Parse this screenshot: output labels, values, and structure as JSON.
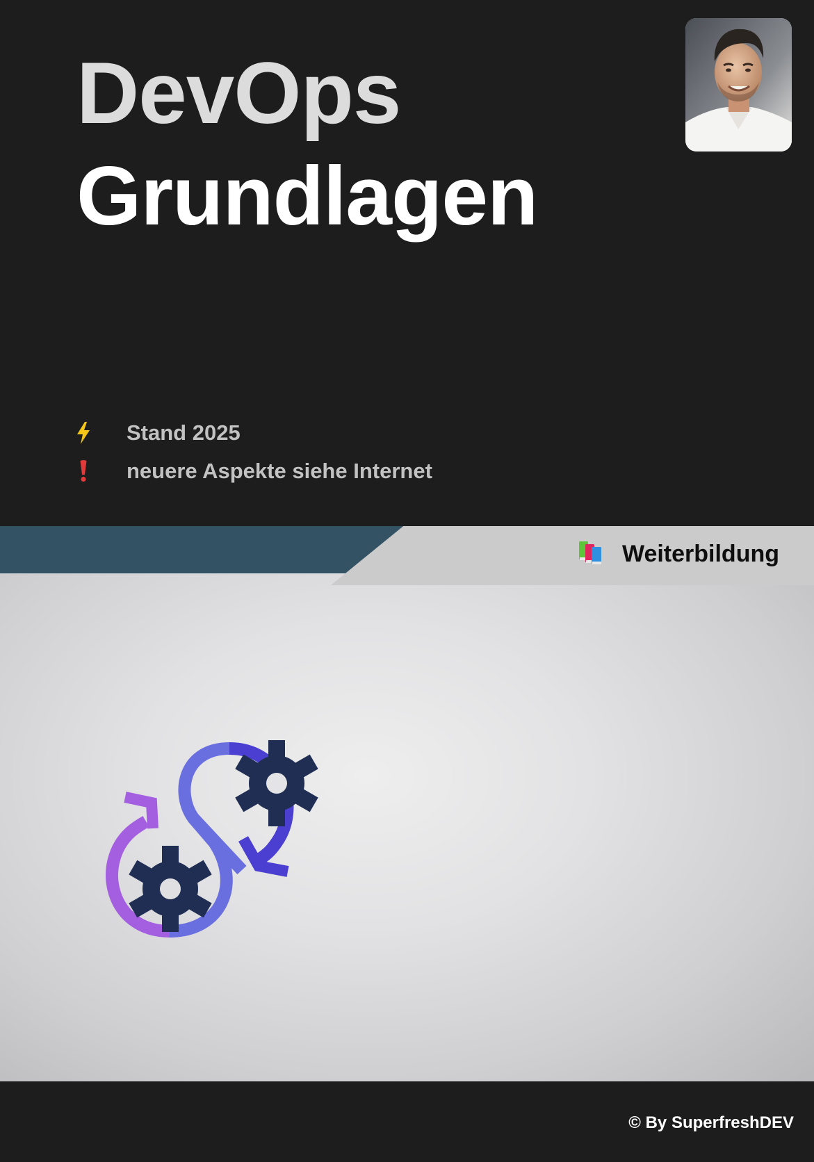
{
  "cover": {
    "title_line1": "DevOps",
    "title_line2": "Grundlagen"
  },
  "author_photo": {
    "alt": "Autorenfoto"
  },
  "info": [
    {
      "icon": "lightning-icon",
      "icon_color": "#f5c518",
      "text": "Stand 2025"
    },
    {
      "icon": "exclamation-icon",
      "icon_color": "#e03a3a",
      "text": "neuere Aspekte siehe Internet"
    }
  ],
  "category": {
    "icon": "books-icon",
    "label": "Weiterbildung"
  },
  "footer": {
    "copyright": "© By SuperfreshDEV"
  },
  "colors": {
    "background": "#1d1d1d",
    "band_blue": "#335263",
    "band_grey": "#cbcbcb",
    "loop_purple": "#a35fe0",
    "loop_indigo": "#6a6fe0",
    "loop_blue": "#4a3fd0",
    "gear_navy": "#1f2e52"
  }
}
